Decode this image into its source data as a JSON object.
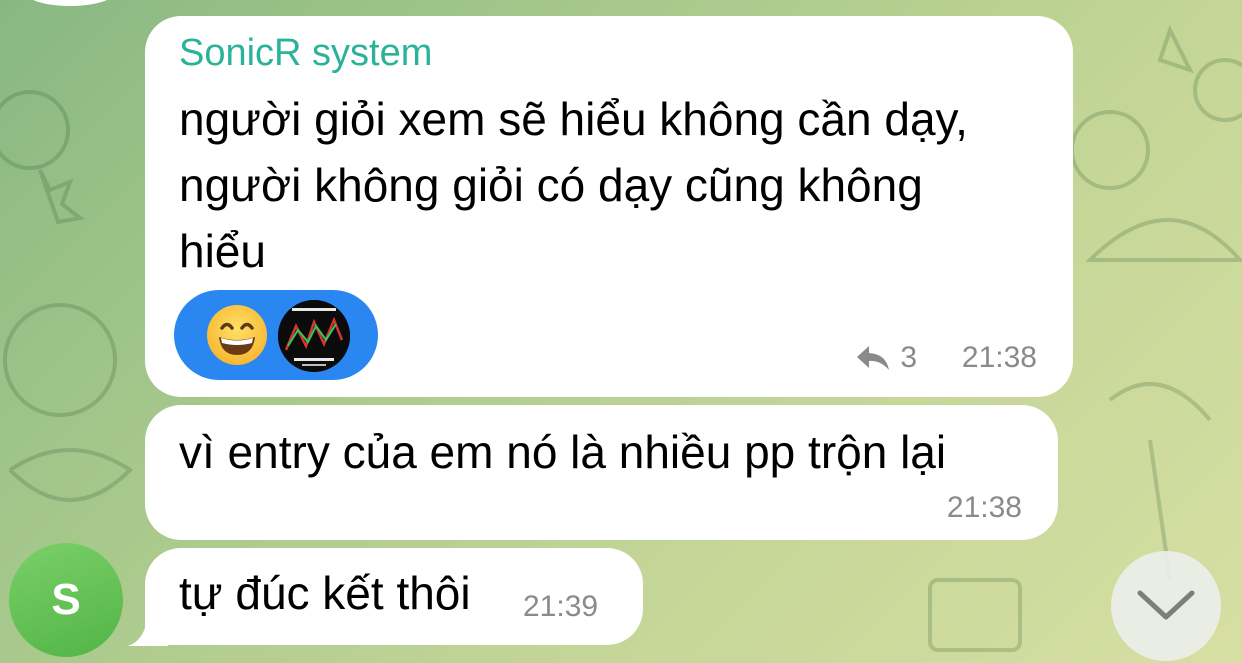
{
  "messages": [
    {
      "sender": "SonicR system",
      "text_lines": [
        "người giỏi xem sẽ hiểu không cần dạy,",
        "người không giỏi có dạy cũng không",
        "hiểu"
      ],
      "reply_count": "3",
      "time": "21:38",
      "reactions": [
        {
          "icon": "grinning-face-emoji"
        },
        {
          "icon": "reactor-avatar"
        }
      ]
    },
    {
      "text": "vì entry của em nó là nhiều pp trộn lại",
      "time": "21:38"
    },
    {
      "text": "tự đúc kết thôi",
      "time": "21:39"
    }
  ],
  "avatar": {
    "initial": "S",
    "color": "#5fbf52"
  },
  "colors": {
    "sender_name": "#2bb39a",
    "reaction_pill": "#2a86f0",
    "bubble": "#ffffff",
    "meta_text": "#8a8a8a"
  }
}
